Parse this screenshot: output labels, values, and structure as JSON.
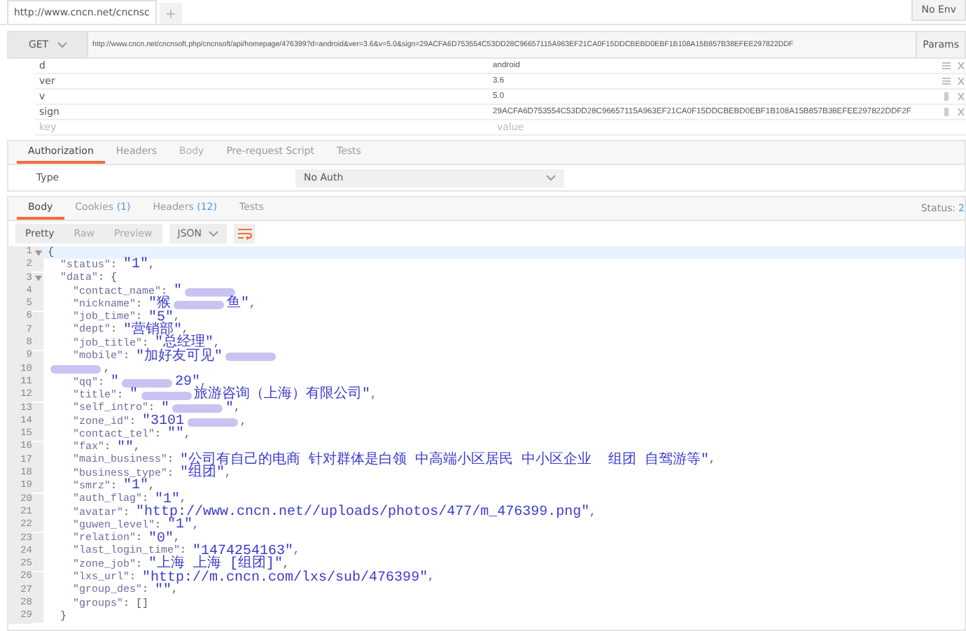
{
  "tabs": [
    {
      "label": "http://www.cncn.net/cncnsc",
      "selected": true
    }
  ],
  "environment": "No Env",
  "request": {
    "method": "GET",
    "url": "http://www.cncn.net/cncnsoft.php/cncnsoft/api/homepage/476399?d=android&ver=3.6&v=5.0&sign=29ACFA6D753554C53DD28C96657115A963EF21CA0F15DDCBEBD0EBF1B108A15B857B38EFEE297822DDF",
    "params_button": "Params"
  },
  "params": [
    {
      "key": "d",
      "value": "android",
      "kind": "lines"
    },
    {
      "key": "ver",
      "value": "3.6",
      "kind": "lines"
    },
    {
      "key": "v",
      "value": "5.0",
      "kind": "bar"
    },
    {
      "key": "sign",
      "value": "29ACFA6D753554C53DD28C96657115A963EF21CA0F15DDCBEBD0EBF1B108A15B857B38EFEE297822DDF2F",
      "kind": "bar"
    }
  ],
  "new_param": {
    "key_placeholder": "key",
    "value_placeholder": "value"
  },
  "request_tabs": [
    {
      "label": "Authorization",
      "selected": true,
      "disabled": false
    },
    {
      "label": "Headers",
      "selected": false,
      "disabled": false
    },
    {
      "label": "Body",
      "selected": false,
      "disabled": true
    },
    {
      "label": "Pre-request Script",
      "selected": false,
      "disabled": false
    },
    {
      "label": "Tests",
      "selected": false,
      "disabled": false
    }
  ],
  "auth": {
    "label": "Type",
    "value": "No Auth"
  },
  "response_tabs": [
    {
      "label": "Body",
      "selected": true
    },
    {
      "label": "Cookies",
      "count": "(1)",
      "selected": false
    },
    {
      "label": "Headers",
      "count": "(12)",
      "selected": false
    },
    {
      "label": "Tests",
      "selected": false
    }
  ],
  "status": {
    "label": "Status:",
    "value": "2"
  },
  "view_modes": [
    {
      "label": "Pretty",
      "selected": true
    },
    {
      "label": "Raw",
      "selected": false
    },
    {
      "label": "Preview",
      "selected": false
    }
  ],
  "format": "JSON",
  "code": [
    {
      "number": "1",
      "fold": true,
      "tokens": [
        {
          "kind": "punct",
          "t": "{"
        }
      ]
    },
    {
      "number": "2",
      "fold": false,
      "tokens": [
        {
          "kind": "key",
          "t": "  \"status\""
        },
        {
          "kind": "punct",
          "t": ": "
        },
        {
          "kind": "str",
          "t": "\"1\""
        },
        {
          "kind": "punct",
          "t": ","
        }
      ]
    },
    {
      "number": "3",
      "fold": true,
      "tokens": [
        {
          "kind": "key",
          "t": "  \"data\""
        },
        {
          "kind": "punct",
          "t": ": {"
        }
      ]
    },
    {
      "number": "4",
      "fold": false,
      "tokens": [
        {
          "kind": "key",
          "t": "    \"contact_name\""
        },
        {
          "kind": "punct",
          "t": ": "
        },
        {
          "kind": "str",
          "t": "\""
        },
        {
          "kind": "blur"
        }
      ]
    },
    {
      "number": "5",
      "fold": false,
      "tokens": [
        {
          "kind": "key",
          "t": "    \"nickname\""
        },
        {
          "kind": "punct",
          "t": ": "
        },
        {
          "kind": "str",
          "t": "\"猴"
        },
        {
          "kind": "blur"
        },
        {
          "kind": "str",
          "t": "鱼\""
        },
        {
          "kind": "punct",
          "t": ","
        }
      ]
    },
    {
      "number": "6",
      "fold": false,
      "tokens": [
        {
          "kind": "key",
          "t": "    \"job_time\""
        },
        {
          "kind": "punct",
          "t": ": "
        },
        {
          "kind": "str",
          "t": "\"5\""
        },
        {
          "kind": "punct",
          "t": ","
        }
      ]
    },
    {
      "number": "7",
      "fold": false,
      "tokens": [
        {
          "kind": "key",
          "t": "    \"dept\""
        },
        {
          "kind": "punct",
          "t": ": "
        },
        {
          "kind": "str",
          "t": "\"营销部\""
        },
        {
          "kind": "punct",
          "t": ","
        }
      ]
    },
    {
      "number": "8",
      "fold": false,
      "tokens": [
        {
          "kind": "key",
          "t": "    \"job_title\""
        },
        {
          "kind": "punct",
          "t": ": "
        },
        {
          "kind": "str",
          "t": "\"总经理\""
        },
        {
          "kind": "punct",
          "t": ","
        }
      ]
    },
    {
      "number": "9",
      "fold": false,
      "tokens": [
        {
          "kind": "key",
          "t": "    \"mobile\""
        },
        {
          "kind": "punct",
          "t": ": "
        },
        {
          "kind": "str",
          "t": "\"加好友可见\""
        },
        {
          "kind": "blur"
        }
      ]
    },
    {
      "number": "10",
      "fold": false,
      "tokens": [
        {
          "kind": "blur"
        },
        {
          "kind": "punct",
          "t": ","
        }
      ]
    },
    {
      "number": "11",
      "fold": false,
      "tokens": [
        {
          "kind": "key",
          "t": "    \"qq\""
        },
        {
          "kind": "punct",
          "t": ": "
        },
        {
          "kind": "str",
          "t": "\""
        },
        {
          "kind": "blur"
        },
        {
          "kind": "str",
          "t": "29\""
        },
        {
          "kind": "punct",
          "t": ","
        }
      ]
    },
    {
      "number": "12",
      "fold": false,
      "tokens": [
        {
          "kind": "key",
          "t": "    \"title\""
        },
        {
          "kind": "punct",
          "t": ": "
        },
        {
          "kind": "str",
          "t": "\""
        },
        {
          "kind": "blur"
        },
        {
          "kind": "str",
          "t": "旅游咨询（上海）有限公司\""
        },
        {
          "kind": "punct",
          "t": ","
        }
      ]
    },
    {
      "number": "13",
      "fold": false,
      "tokens": [
        {
          "kind": "key",
          "t": "    \"self_intro\""
        },
        {
          "kind": "punct",
          "t": ": "
        },
        {
          "kind": "str",
          "t": "\""
        },
        {
          "kind": "blur"
        },
        {
          "kind": "str",
          "t": "\""
        },
        {
          "kind": "punct",
          "t": ","
        }
      ]
    },
    {
      "number": "14",
      "fold": false,
      "tokens": [
        {
          "kind": "key",
          "t": "    \"zone_id\""
        },
        {
          "kind": "punct",
          "t": ": "
        },
        {
          "kind": "str",
          "t": "\"3101"
        },
        {
          "kind": "blur"
        },
        {
          "kind": "punct",
          "t": ","
        }
      ]
    },
    {
      "number": "15",
      "fold": false,
      "tokens": [
        {
          "kind": "key",
          "t": "    \"contact_tel\""
        },
        {
          "kind": "punct",
          "t": ": "
        },
        {
          "kind": "str",
          "t": "\"\""
        },
        {
          "kind": "punct",
          "t": ","
        }
      ]
    },
    {
      "number": "16",
      "fold": false,
      "tokens": [
        {
          "kind": "key",
          "t": "    \"fax\""
        },
        {
          "kind": "punct",
          "t": ": "
        },
        {
          "kind": "str",
          "t": "\"\""
        },
        {
          "kind": "punct",
          "t": ","
        }
      ]
    },
    {
      "number": "17",
      "fold": false,
      "tokens": [
        {
          "kind": "key",
          "t": "    \"main_business\""
        },
        {
          "kind": "punct",
          "t": ": "
        },
        {
          "kind": "str",
          "t": "\"公司有自己的电商 针对群体是白领 中高端小区居民 中小区企业  组团 自驾游等\""
        },
        {
          "kind": "punct",
          "t": ","
        }
      ]
    },
    {
      "number": "18",
      "fold": false,
      "tokens": [
        {
          "kind": "key",
          "t": "    \"business_type\""
        },
        {
          "kind": "punct",
          "t": ": "
        },
        {
          "kind": "str",
          "t": "\"组团\""
        },
        {
          "kind": "punct",
          "t": ","
        }
      ]
    },
    {
      "number": "19",
      "fold": false,
      "tokens": [
        {
          "kind": "key",
          "t": "    \"smrz\""
        },
        {
          "kind": "punct",
          "t": ": "
        },
        {
          "kind": "str",
          "t": "\"1\""
        },
        {
          "kind": "punct",
          "t": ","
        }
      ]
    },
    {
      "number": "20",
      "fold": false,
      "tokens": [
        {
          "kind": "key",
          "t": "    \"auth_flag\""
        },
        {
          "kind": "punct",
          "t": ": "
        },
        {
          "kind": "str",
          "t": "\"1\""
        },
        {
          "kind": "punct",
          "t": ","
        }
      ]
    },
    {
      "number": "21",
      "fold": false,
      "tokens": [
        {
          "kind": "key",
          "t": "    \"avatar\""
        },
        {
          "kind": "punct",
          "t": ": "
        },
        {
          "kind": "str",
          "t": "\"http://www.cncn.net//uploads/photos/477/m_476399.png\""
        },
        {
          "kind": "punct",
          "t": ","
        }
      ]
    },
    {
      "number": "22",
      "fold": false,
      "tokens": [
        {
          "kind": "key",
          "t": "    \"guwen_level\""
        },
        {
          "kind": "punct",
          "t": ": "
        },
        {
          "kind": "str",
          "t": "\"1\""
        },
        {
          "kind": "punct",
          "t": ","
        }
      ]
    },
    {
      "number": "23",
      "fold": false,
      "tokens": [
        {
          "kind": "key",
          "t": "    \"relation\""
        },
        {
          "kind": "punct",
          "t": ": "
        },
        {
          "kind": "str",
          "t": "\"0\""
        },
        {
          "kind": "punct",
          "t": ","
        }
      ]
    },
    {
      "number": "24",
      "fold": false,
      "tokens": [
        {
          "kind": "key",
          "t": "    \"last_login_time\""
        },
        {
          "kind": "punct",
          "t": ": "
        },
        {
          "kind": "str",
          "t": "\"1474254163\""
        },
        {
          "kind": "punct",
          "t": ","
        }
      ]
    },
    {
      "number": "25",
      "fold": false,
      "tokens": [
        {
          "kind": "key",
          "t": "    \"zone_job\""
        },
        {
          "kind": "punct",
          "t": ": "
        },
        {
          "kind": "str",
          "t": "\"上海 上海 [组团]\""
        },
        {
          "kind": "punct",
          "t": ","
        }
      ]
    },
    {
      "number": "26",
      "fold": false,
      "tokens": [
        {
          "kind": "key",
          "t": "    \"lxs_url\""
        },
        {
          "kind": "punct",
          "t": ": "
        },
        {
          "kind": "str",
          "t": "\"http://m.cncn.com/lxs/sub/476399\""
        },
        {
          "kind": "punct",
          "t": ","
        }
      ]
    },
    {
      "number": "27",
      "fold": false,
      "tokens": [
        {
          "kind": "key",
          "t": "    \"group_des\""
        },
        {
          "kind": "punct",
          "t": ": "
        },
        {
          "kind": "str",
          "t": "\"\""
        },
        {
          "kind": "punct",
          "t": ","
        }
      ]
    },
    {
      "number": "28",
      "fold": false,
      "tokens": [
        {
          "kind": "key",
          "t": "    \"groups\""
        },
        {
          "kind": "punct",
          "t": ": []"
        }
      ]
    },
    {
      "number": "29",
      "fold": false,
      "tokens": [
        {
          "kind": "punct",
          "t": "  }"
        }
      ]
    }
  ]
}
